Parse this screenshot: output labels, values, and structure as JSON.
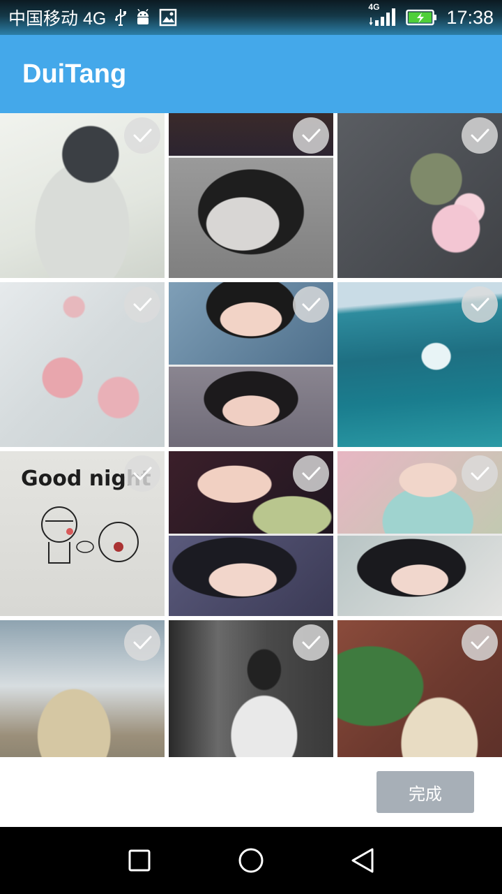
{
  "status_bar": {
    "carrier": "中国移动 4G",
    "network_badge": "4G",
    "time": "17:38",
    "icons": [
      "usb-icon",
      "android-icon",
      "image-icon",
      "signal-icon",
      "battery-charging-icon"
    ]
  },
  "app_bar": {
    "title": "DuiTang"
  },
  "grid": {
    "columns": 3,
    "tiles": [
      {
        "id": "photo-1",
        "description": "illustrated girl in white dress",
        "selected": false
      },
      {
        "id": "photo-2",
        "description": "black and white portrait",
        "selected": false
      },
      {
        "id": "photo-3",
        "description": "pink carnation flowers on gray",
        "selected": false
      },
      {
        "id": "photo-4",
        "description": "pink rose on soft background",
        "selected": false
      },
      {
        "id": "photo-5",
        "description": "portrait collage",
        "selected": false
      },
      {
        "id": "photo-6",
        "description": "ocean waves and beach",
        "selected": false
      },
      {
        "id": "photo-7",
        "description": "good night cartoon",
        "selected": false,
        "text": "Good night"
      },
      {
        "id": "photo-8",
        "description": "portrait collage",
        "selected": false
      },
      {
        "id": "photo-9",
        "description": "portrait collage",
        "selected": false
      },
      {
        "id": "photo-10",
        "description": "alpaca by fence",
        "selected": false
      },
      {
        "id": "photo-11",
        "description": "woman sitting, black and white",
        "selected": false
      },
      {
        "id": "photo-12",
        "description": "woman by brick wall with plants",
        "selected": false
      }
    ]
  },
  "actions": {
    "done_label": "完成"
  },
  "colors": {
    "app_bar": "#44a8ea",
    "done_button": "#a7afb7",
    "nav_bar": "#000000",
    "check_overlay": "#dcdcdc"
  }
}
